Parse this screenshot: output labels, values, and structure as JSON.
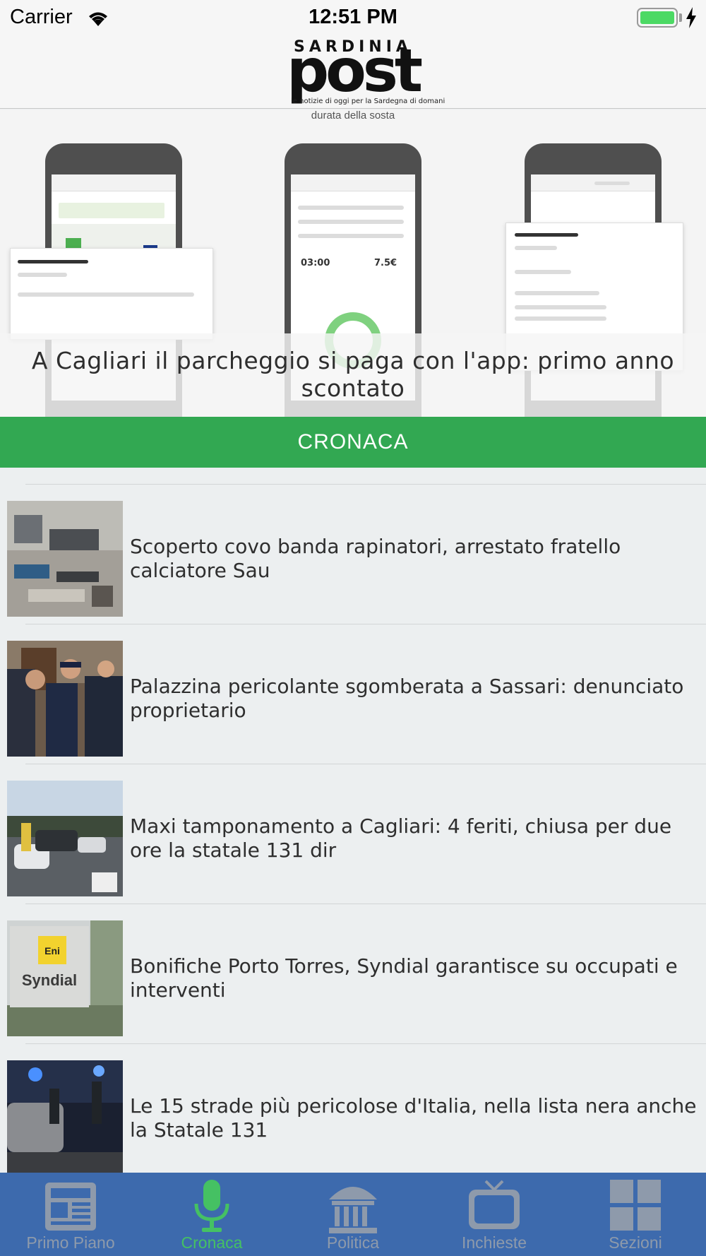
{
  "status_bar": {
    "carrier": "Carrier",
    "time": "12:51 PM",
    "battery_color": "#4cd964"
  },
  "header": {
    "logo_top": "SARDINIA",
    "logo_main": "post",
    "logo_tagline": "le notizie di oggi per la Sardegna di domani"
  },
  "hero": {
    "image_caption": "durata della sosta",
    "title": "A Cagliari il parcheggio si paga con l'app: primo anno scontato"
  },
  "section": {
    "label": "CRONACA",
    "color": "#32a852"
  },
  "articles": [
    {
      "title": "Scoperto covo banda rapinatori, arrestato fratello calciatore Sau"
    },
    {
      "title": "Palazzina pericolante sgomberata a Sassari: denunciato proprietario"
    },
    {
      "title": "Maxi tamponamento a Cagliari: 4 feriti, chiusa per due ore la statale 131 dir"
    },
    {
      "title": "Bonifiche Porto Torres, Syndial garantisce su occupati e interventi",
      "image_text_1": "Eni",
      "image_text_2": "Syndial"
    },
    {
      "title": "Le 15 strade più pericolose d'Italia, nella lista nera anche la Statale 131"
    }
  ],
  "tab_bar": {
    "background": "#3d6aad",
    "active_color": "#45c163",
    "tabs": [
      {
        "label": "Primo Piano",
        "icon": "newspaper-icon"
      },
      {
        "label": "Cronaca",
        "icon": "microphone-icon",
        "active": true
      },
      {
        "label": "Politica",
        "icon": "building-icon"
      },
      {
        "label": "Inchieste",
        "icon": "tv-icon"
      },
      {
        "label": "Sezioni",
        "icon": "grid-icon"
      }
    ]
  }
}
